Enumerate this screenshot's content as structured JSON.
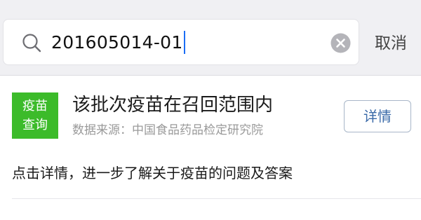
{
  "search": {
    "query": "201605014-01",
    "cancel_label": "取消"
  },
  "result": {
    "badge_line1": "疫苗",
    "badge_line2": "查询",
    "title": "该批次疫苗在召回范围内",
    "source": "数据来源：中国食品药品检定研究院",
    "details_label": "详情",
    "description": "点击详情，进一步了解关于疫苗的问题及答案"
  },
  "colors": {
    "badge_green": "#3cbb2a",
    "link_blue": "#3a6aa8",
    "caret_blue": "#1b6df5"
  },
  "icons": {
    "search": "search-icon",
    "clear": "clear-icon"
  }
}
